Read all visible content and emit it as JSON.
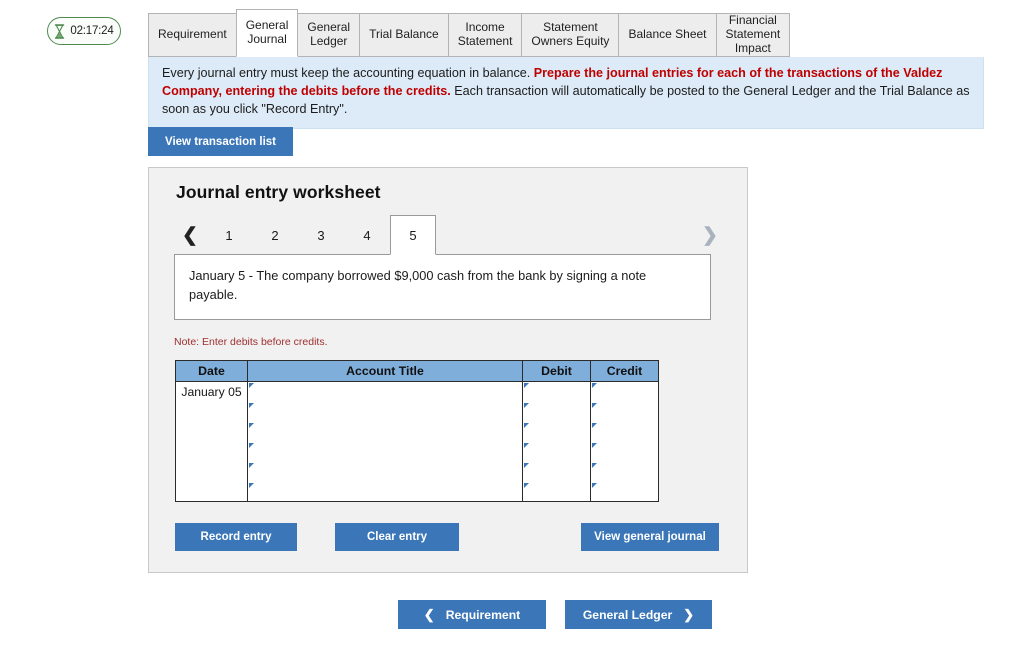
{
  "timer": {
    "icon": "hourglass-icon",
    "value": "02:17:24",
    "border_color": "#4e8a4e"
  },
  "tabs": [
    {
      "label": "Requirement",
      "active": false
    },
    {
      "label": "General\nJournal",
      "active": true
    },
    {
      "label": "General\nLedger",
      "active": false
    },
    {
      "label": "Trial Balance",
      "active": false
    },
    {
      "label": "Income\nStatement",
      "active": false
    },
    {
      "label": "Statement\nOwners Equity",
      "active": false
    },
    {
      "label": "Balance Sheet",
      "active": false
    },
    {
      "label": "Financial\nStatement\nImpact",
      "active": false
    }
  ],
  "banner": {
    "part1": "Every journal entry must keep the accounting equation in balance.  ",
    "emphasis": "Prepare the journal entries for each of the transactions of the Valdez Company, entering the debits before the credits.",
    "part2": "  Each transaction will automatically be posted to the General Ledger and the Trial Balance as soon as you click \"Record Entry\".",
    "background": "#dcebf7",
    "emphasis_color": "#c00000"
  },
  "toolbar": {
    "view_transaction_list": "View transaction list"
  },
  "worksheet": {
    "title": "Journal entry worksheet",
    "pager": {
      "prev_icon": "chevron-left-icon",
      "next_icon": "chevron-right-icon",
      "pages": [
        "1",
        "2",
        "3",
        "4",
        "5"
      ],
      "active_page": "5"
    },
    "transaction_text": "January 5 - The company borrowed $9,000 cash from the bank by signing a note payable.",
    "note": "Note: Enter debits before credits.",
    "table": {
      "headers": [
        "Date",
        "Account Title",
        "Debit",
        "Credit"
      ],
      "rows": [
        {
          "date": "January 05",
          "account_title": "",
          "debit": "",
          "credit": ""
        },
        {
          "date": "",
          "account_title": "",
          "debit": "",
          "credit": ""
        },
        {
          "date": "",
          "account_title": "",
          "debit": "",
          "credit": ""
        },
        {
          "date": "",
          "account_title": "",
          "debit": "",
          "credit": ""
        },
        {
          "date": "",
          "account_title": "",
          "debit": "",
          "credit": ""
        },
        {
          "date": "",
          "account_title": "",
          "debit": "",
          "credit": ""
        }
      ],
      "header_background": "#80aeda"
    },
    "actions": {
      "record_entry": "Record entry",
      "clear_entry": "Clear entry",
      "view_general_journal": "View general journal"
    }
  },
  "footer": {
    "prev_button": {
      "label": "Requirement",
      "icon": "chevron-left-icon"
    },
    "next_button": {
      "label": "General Ledger",
      "icon": "chevron-right-icon"
    }
  },
  "colors": {
    "primary_button": "#3b77b8",
    "panel_background": "#f1f1f1"
  }
}
